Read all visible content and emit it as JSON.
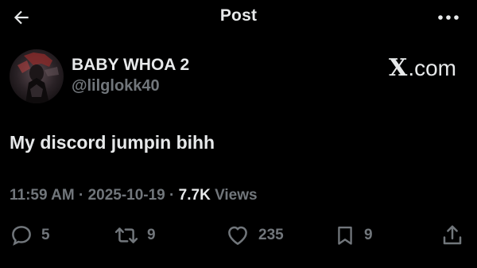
{
  "header": {
    "title": "Post",
    "back_icon": "arrow-left-icon",
    "more_icon": "more-horizontal-icon"
  },
  "author": {
    "display_name": "BABY WHOA 2",
    "handle": "@lilglokk40"
  },
  "source": {
    "brand": "X",
    "brand_suffix": ".com"
  },
  "tweet": {
    "text": "My discord jumpin bihh"
  },
  "meta": {
    "time": "11:59 AM",
    "separator": " · ",
    "date": "2025-10-19",
    "views_count": "7.7K",
    "views_label": " Views"
  },
  "actions": {
    "replies": "5",
    "reposts": "9",
    "likes": "235",
    "bookmarks": "9"
  },
  "colors": {
    "background": "#000000",
    "text_primary": "#e7e9ea",
    "text_secondary": "#71767b"
  }
}
